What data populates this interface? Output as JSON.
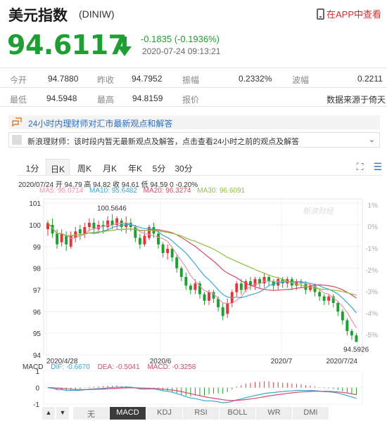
{
  "header": {
    "title": "美元指数",
    "code": "(DINIW)",
    "app_link": "在APP中查看"
  },
  "quote": {
    "price": "94.6117",
    "change": "-0.1835 (-0.1936%)",
    "timestamp": "2020-07-24 09:13:21",
    "trend_color": "#1f9e33"
  },
  "stats": {
    "row1": [
      {
        "label": "今开",
        "value": "94.7880"
      },
      {
        "label": "昨收",
        "value": "94.7952"
      },
      {
        "label": "振幅",
        "value": "0.2332%"
      },
      {
        "label": "波幅",
        "value": "0.2211"
      }
    ],
    "row2": [
      {
        "label": "最低",
        "value": "94.5948"
      },
      {
        "label": "最高",
        "value": "94.8159"
      },
      {
        "label": "报价",
        "value": ""
      },
      {
        "label": "",
        "value": "数据来源于倚天"
      }
    ]
  },
  "news": {
    "headline": "24小时内理财师对汇市最新观点和解答",
    "message": "新浪理财师：该时段内暂无最新观点及解答，点击查看24小时之前的观点及解答",
    "expand_icon": "chevron-down-icon"
  },
  "tabs": [
    "1分",
    "日K",
    "周K",
    "月K",
    "年K",
    "5分",
    "30分"
  ],
  "active_tab": "日K",
  "toolbar": {
    "fullscreen_icon": "fullscreen-icon",
    "settings_icon": "sliders-icon"
  },
  "ohlc": "2020/07/24 开 94.79 高 94.82 收 94.61 低 94.59 0 -0.20%",
  "ma_legend": [
    {
      "label": "MA5: 95.0714",
      "color": "#f08fa8"
    },
    {
      "label": "MA10: 95.6482",
      "color": "#3aa7d6"
    },
    {
      "label": "MA20: 96.3274",
      "color": "#d64a6a"
    },
    {
      "label": "MA30: 96.6091",
      "color": "#8fbf3a"
    }
  ],
  "macd_legend": [
    {
      "label": "MACD",
      "color": "#333333"
    },
    {
      "label": "DIF: -0.6670",
      "color": "#3aa7d6"
    },
    {
      "label": "DEA: -0.5041",
      "color": "#d64a6a"
    },
    {
      "label": "MACD: -0.3258",
      "color": "#d64a6a"
    }
  ],
  "indicator_nav": [
    "▲",
    "▼"
  ],
  "indicator_buttons": [
    "无",
    "MACD",
    "KDJ",
    "RSI",
    "BOLL",
    "WR",
    "DMI"
  ],
  "active_indicator": "MACD",
  "watermark": "新浪财经",
  "chart_data": {
    "type": "candlestick",
    "y_ticks": [
      "101",
      "100",
      "99",
      "98",
      "97",
      "96",
      "95",
      "94"
    ],
    "y_pct_ticks": [
      "1%",
      "0%",
      "-1%",
      "-2%",
      "-3%",
      "-4%",
      "-5%"
    ],
    "x_ticks": [
      "2020/4/28",
      "2020/6",
      "2020/7",
      "2020/7/24"
    ],
    "ylim": [
      94,
      101.2
    ],
    "annotations": {
      "high": "100.5646",
      "low": "94.5926"
    },
    "macd_ticks": [
      "1",
      "0",
      "-1"
    ],
    "candles": [
      [
        99.8,
        100.1,
        99.5,
        100.2
      ],
      [
        100.0,
        99.6,
        99.4,
        100.3
      ],
      [
        99.6,
        99.1,
        98.9,
        99.8
      ],
      [
        99.2,
        99.6,
        99.0,
        99.8
      ],
      [
        99.5,
        99.1,
        98.8,
        99.7
      ],
      [
        99.0,
        99.5,
        98.9,
        99.7
      ],
      [
        99.4,
        99.7,
        99.2,
        99.9
      ],
      [
        99.8,
        99.6,
        99.3,
        100.0
      ],
      [
        99.6,
        99.9,
        99.4,
        100.1
      ],
      [
        99.9,
        100.1,
        99.7,
        100.3
      ],
      [
        100.1,
        99.8,
        99.6,
        100.3
      ],
      [
        99.8,
        100.0,
        99.6,
        100.2
      ],
      [
        100.0,
        99.9,
        99.6,
        100.2
      ],
      [
        99.9,
        100.2,
        99.7,
        100.4
      ],
      [
        100.2,
        100.0,
        99.8,
        100.5
      ],
      [
        100.0,
        100.3,
        99.8,
        100.4
      ],
      [
        100.2,
        99.9,
        99.7,
        100.3
      ],
      [
        99.9,
        100.1,
        99.6,
        100.4
      ],
      [
        100.1,
        99.9,
        99.7,
        100.3
      ],
      [
        99.9,
        99.4,
        99.2,
        100.0
      ],
      [
        99.4,
        99.1,
        98.9,
        99.6
      ],
      [
        99.1,
        99.5,
        99.0,
        99.7
      ],
      [
        99.4,
        99.9,
        99.3,
        100.0
      ],
      [
        99.9,
        99.6,
        99.4,
        100.1
      ],
      [
        99.6,
        99.1,
        98.9,
        99.8
      ],
      [
        99.1,
        98.7,
        98.5,
        99.2
      ],
      [
        98.7,
        98.9,
        98.4,
        99.1
      ],
      [
        98.9,
        98.5,
        98.3,
        99.0
      ],
      [
        98.5,
        98.0,
        97.8,
        98.6
      ],
      [
        98.0,
        97.6,
        97.4,
        98.1
      ],
      [
        97.6,
        97.2,
        97.0,
        97.8
      ],
      [
        97.2,
        97.0,
        96.8,
        97.3
      ],
      [
        97.0,
        97.3,
        96.8,
        97.5
      ],
      [
        97.3,
        96.8,
        96.6,
        97.4
      ],
      [
        96.8,
        96.5,
        96.3,
        96.9
      ],
      [
        96.5,
        96.9,
        96.3,
        97.0
      ],
      [
        96.9,
        96.6,
        96.4,
        97.0
      ],
      [
        96.6,
        96.2,
        96.0,
        96.7
      ],
      [
        96.2,
        95.8,
        95.6,
        96.4
      ],
      [
        95.9,
        96.4,
        95.7,
        96.6
      ],
      [
        96.4,
        96.9,
        96.2,
        97.0
      ],
      [
        96.9,
        97.3,
        96.7,
        97.4
      ],
      [
        97.3,
        97.0,
        96.8,
        97.5
      ],
      [
        97.0,
        97.4,
        96.9,
        97.5
      ],
      [
        97.4,
        97.2,
        97.0,
        97.6
      ],
      [
        97.2,
        97.5,
        97.0,
        97.6
      ],
      [
        97.5,
        97.3,
        97.1,
        97.6
      ],
      [
        97.3,
        97.6,
        97.1,
        97.8
      ],
      [
        97.6,
        97.4,
        97.2,
        97.7
      ],
      [
        97.4,
        97.2,
        97.0,
        97.5
      ],
      [
        97.2,
        97.5,
        97.0,
        97.6
      ],
      [
        97.5,
        97.3,
        97.1,
        97.6
      ],
      [
        97.3,
        97.5,
        97.1,
        97.6
      ],
      [
        97.5,
        97.2,
        97.0,
        97.6
      ],
      [
        97.2,
        97.4,
        97.0,
        97.5
      ],
      [
        97.4,
        97.3,
        97.1,
        97.5
      ],
      [
        97.3,
        97.0,
        96.8,
        97.4
      ],
      [
        97.0,
        97.2,
        96.9,
        97.3
      ],
      [
        97.2,
        96.9,
        96.7,
        97.3
      ],
      [
        96.9,
        96.7,
        96.5,
        97.0
      ],
      [
        96.7,
        96.5,
        96.3,
        96.8
      ],
      [
        96.5,
        96.7,
        96.3,
        96.8
      ],
      [
        96.7,
        96.4,
        96.2,
        96.8
      ],
      [
        96.4,
        96.0,
        95.8,
        96.5
      ],
      [
        96.0,
        95.6,
        95.4,
        96.1
      ],
      [
        95.6,
        95.1,
        94.9,
        95.7
      ],
      [
        95.1,
        94.9,
        94.7,
        95.2
      ],
      [
        94.9,
        94.6,
        94.6,
        95.0
      ]
    ]
  }
}
